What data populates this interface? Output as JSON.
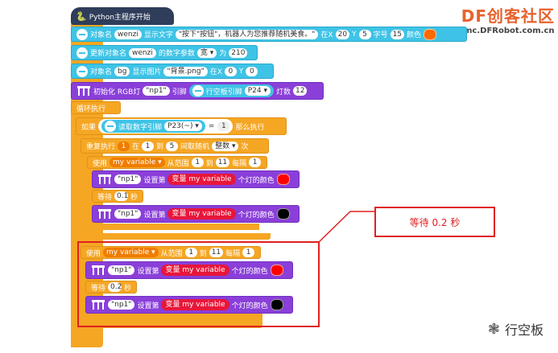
{
  "watermark": {
    "site": "DF创客社区",
    "url": "mc.DFRobot.com.cn"
  },
  "hat": {
    "label": "Python主程序开始"
  },
  "blocks": {
    "show_text": {
      "prefix": "对象名",
      "obj": "wenzi",
      "mid": "显示文字",
      "text": "\"按下\"按钮\"，机器人为您推荐随机美食。\"",
      "x_label": "在X",
      "x": "20",
      "y_label": "Y",
      "y": "5",
      "size_label": "字号",
      "size": "15",
      "color_label": "颜色",
      "color": "#ff6a00"
    },
    "update_num": {
      "prefix": "更新对象名",
      "obj": "wenzi",
      "mid": "的数字参数",
      "param": "宽",
      "to": "为",
      "value": "210"
    },
    "show_image": {
      "prefix": "对象名",
      "obj": "bg",
      "mid": "显示图片",
      "file": "\"背景.png\"",
      "x_label": "在X",
      "x": "0",
      "y_label": "Y",
      "y": "0"
    },
    "init_rgb": {
      "label": "初始化 RGB灯",
      "name": "\"np1\"",
      "pin_label": "引脚",
      "pin_board": "行空板引脚",
      "pin": "P24",
      "count_label": "灯数",
      "count": "12"
    },
    "loop": {
      "label": "循环执行"
    },
    "if_block": {
      "if": "如果",
      "read": "读取数字引脚",
      "pin": "P23(~)",
      "eq": "=",
      "value": "1",
      "then": "那么执行"
    },
    "repeat": {
      "label": "重复执行",
      "n": "1",
      "in": "在",
      "from": "1",
      "to_label": "到",
      "to": "5",
      "rand": "间取随机",
      "kind": "整数",
      "times": "次"
    },
    "for1": {
      "use": "使用",
      "var": "my variable",
      "range": "从范围",
      "start": "1",
      "to": "到",
      "end": "11",
      "step_label": "每隔",
      "step": "1"
    },
    "set1a": {
      "name": "\"np1\"",
      "set": "设置第",
      "var_label": "变量 my variable",
      "suffix": "个灯的颜色",
      "color": "#ff0000"
    },
    "wait1": {
      "label": "等待",
      "value": "0.1",
      "unit": "秒"
    },
    "set1b": {
      "name": "\"np1\"",
      "set": "设置第",
      "var_label": "变量 my variable",
      "suffix": "个灯的颜色",
      "color": "#000000"
    },
    "for2": {
      "use": "使用",
      "var": "my variable",
      "range": "从范围",
      "start": "1",
      "to": "到",
      "end": "11",
      "step_label": "每隔",
      "step": "1"
    },
    "set2a": {
      "name": "\"np1\"",
      "set": "设置第",
      "var_label": "变量 my variable",
      "suffix": "个灯的颜色",
      "color": "#ff0000"
    },
    "wait2": {
      "label": "等待",
      "value": "0.2",
      "unit": "秒"
    },
    "set2b": {
      "name": "\"np1\"",
      "set": "设置第",
      "var_label": "变量 my variable",
      "suffix": "个灯的颜色",
      "color": "#000000"
    }
  },
  "callout": {
    "text": "等待 0.2 秒"
  },
  "footer": {
    "brand": "行空板"
  }
}
